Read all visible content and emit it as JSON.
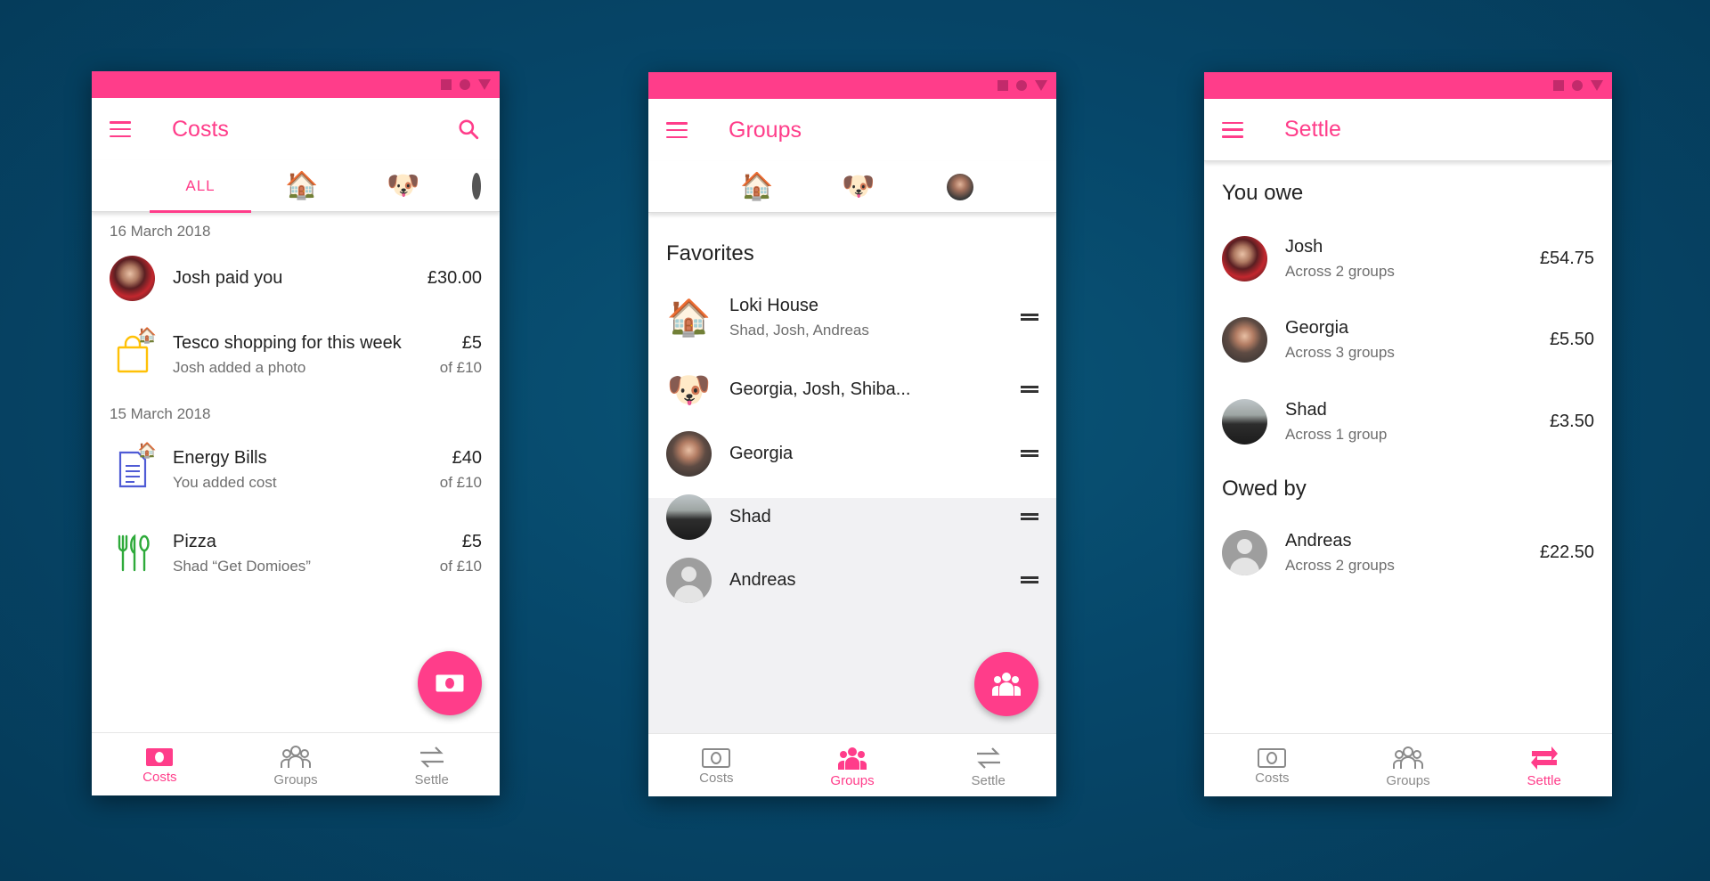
{
  "colors": {
    "accent": "#ff3d8a",
    "background": "#06476a",
    "statusbar_icons": "#c22a6b"
  },
  "costs": {
    "title": "Costs",
    "tabs": [
      {
        "label": "ALL",
        "active": true
      },
      {
        "icon": "🏠"
      },
      {
        "icon": "🐶"
      }
    ],
    "sections": [
      {
        "date": "16 March 2018",
        "items": [
          {
            "title": "Josh paid you",
            "amount": "£30.00"
          },
          {
            "title": "Tesco shopping for this week",
            "subtitle": "Josh added a photo",
            "amount": "£5",
            "share": "of £10",
            "icon": "shopping-bag-icon",
            "badge": "🏠"
          }
        ]
      },
      {
        "date": "15 March 2018",
        "items": [
          {
            "title": "Energy Bills",
            "subtitle": "You added cost",
            "amount": "£40",
            "share": "of £10",
            "icon": "document-icon",
            "badge": "🏠"
          },
          {
            "title": "Pizza",
            "subtitle": "Shad “Get Domioes”",
            "amount": "£5",
            "share": "of £10",
            "icon": "cutlery-icon"
          }
        ]
      }
    ]
  },
  "groups": {
    "title": "Groups",
    "tabs": [
      {
        "icon": "🏠"
      },
      {
        "icon": "🐶"
      },
      {
        "icon": "avatar"
      }
    ],
    "favorites_label": "Favorites",
    "items": [
      {
        "title": "Loki House",
        "subtitle": "Shad, Josh, Andreas",
        "icon": "🏠"
      },
      {
        "title": "Georgia, Josh, Shiba...",
        "icon": "🐶"
      },
      {
        "title": "Georgia"
      },
      {
        "title": "Shad"
      },
      {
        "title": "Andreas"
      }
    ]
  },
  "settle": {
    "title": "Settle",
    "you_owe_label": "You owe",
    "owed_by_label": "Owed by",
    "you_owe": [
      {
        "name": "Josh",
        "detail": "Across 2 groups",
        "amount": "£54.75"
      },
      {
        "name": "Georgia",
        "detail": "Across 3 groups",
        "amount": "£5.50"
      },
      {
        "name": "Shad",
        "detail": "Across 1 group",
        "amount": "£3.50"
      }
    ],
    "owed_by": [
      {
        "name": "Andreas",
        "detail": "Across 2 groups",
        "amount": "£22.50"
      }
    ]
  },
  "nav": {
    "costs": "Costs",
    "groups": "Groups",
    "settle": "Settle"
  }
}
